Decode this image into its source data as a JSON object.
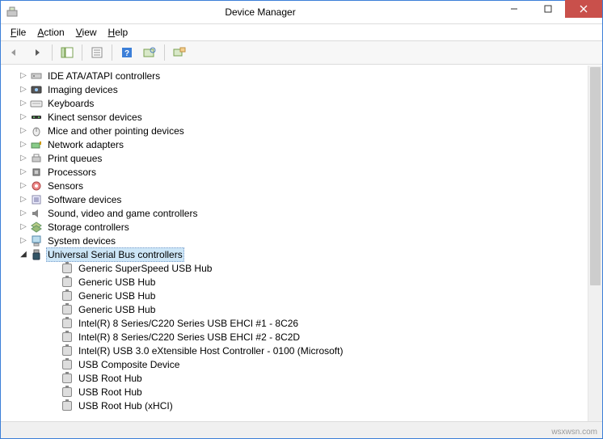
{
  "window": {
    "title": "Device Manager"
  },
  "menus": {
    "file": "File",
    "action": "Action",
    "view": "View",
    "help": "Help"
  },
  "tree": {
    "categories": [
      {
        "label": "IDE ATA/ATAPI controllers",
        "icon": "ide"
      },
      {
        "label": "Imaging devices",
        "icon": "imaging"
      },
      {
        "label": "Keyboards",
        "icon": "keyboard"
      },
      {
        "label": "Kinect sensor devices",
        "icon": "kinect"
      },
      {
        "label": "Mice and other pointing devices",
        "icon": "mouse"
      },
      {
        "label": "Network adapters",
        "icon": "network"
      },
      {
        "label": "Print queues",
        "icon": "printer"
      },
      {
        "label": "Processors",
        "icon": "cpu"
      },
      {
        "label": "Sensors",
        "icon": "sensor"
      },
      {
        "label": "Software devices",
        "icon": "software"
      },
      {
        "label": "Sound, video and game controllers",
        "icon": "sound"
      },
      {
        "label": "Storage controllers",
        "icon": "storage"
      },
      {
        "label": "System devices",
        "icon": "system"
      }
    ],
    "usb": {
      "label": "Universal Serial Bus controllers",
      "selected": true,
      "children": [
        "Generic SuperSpeed USB Hub",
        "Generic USB Hub",
        "Generic USB Hub",
        "Generic USB Hub",
        "Intel(R) 8 Series/C220 Series USB EHCI #1 - 8C26",
        "Intel(R) 8 Series/C220 Series USB EHCI #2 - 8C2D",
        "Intel(R) USB 3.0 eXtensible Host Controller - 0100 (Microsoft)",
        "USB Composite Device",
        "USB Root Hub",
        "USB Root Hub",
        "USB Root Hub (xHCI)"
      ]
    }
  },
  "watermark": "wsxwsn.com"
}
